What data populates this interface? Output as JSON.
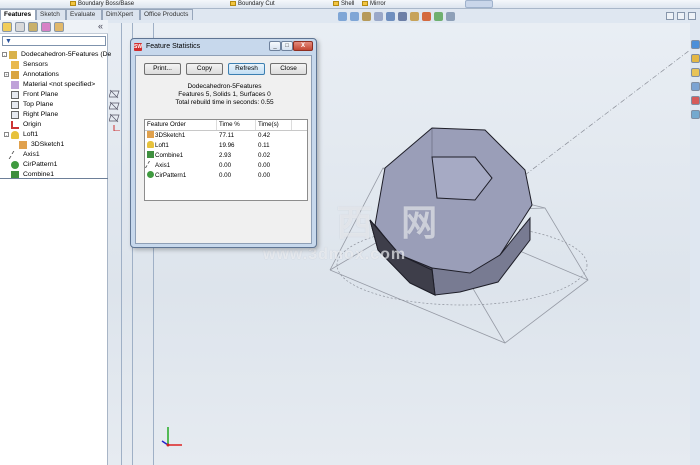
{
  "commandbar": {
    "items": [
      "Boundary Boss/Base",
      "Boundary Cut",
      "Shell",
      "Mirror"
    ]
  },
  "tabs": [
    "Features",
    "Sketch",
    "Evaluate",
    "DimXpert",
    "Office Products"
  ],
  "featuremanager": {
    "filter_icon": "funnel-icon",
    "collapse_glyph": "«",
    "items": [
      {
        "label": "Dodecahedron-5Features  (De",
        "icon": "part-icon",
        "expand": "-"
      },
      {
        "label": "Sensors",
        "icon": "sensor-icon",
        "expand": ""
      },
      {
        "label": "Annotations",
        "icon": "annotation-icon",
        "expand": "+"
      },
      {
        "label": "Material <not specified>",
        "icon": "material-icon",
        "expand": ""
      },
      {
        "label": "Front Plane",
        "icon": "plane-icon",
        "expand": ""
      },
      {
        "label": "Top Plane",
        "icon": "plane-icon",
        "expand": ""
      },
      {
        "label": "Right Plane",
        "icon": "plane-icon",
        "expand": ""
      },
      {
        "label": "Origin",
        "icon": "origin-icon",
        "expand": ""
      },
      {
        "label": "Loft1",
        "icon": "loft-icon",
        "expand": "-"
      },
      {
        "label": "3DSketch1",
        "icon": "sketch3d-icon",
        "expand": ""
      },
      {
        "label": "Axis1",
        "icon": "axis-icon",
        "expand": ""
      },
      {
        "label": "CirPattern1",
        "icon": "circular-pattern-icon",
        "expand": ""
      },
      {
        "label": "Combine1",
        "icon": "combine-icon",
        "expand": ""
      }
    ]
  },
  "dialog": {
    "title": "Feature Statistics",
    "logo": "SW",
    "window_buttons": {
      "minimize": "_",
      "maximize": "□",
      "close": "X"
    },
    "buttons": {
      "print": "Print...",
      "copy": "Copy",
      "refresh": "Refresh",
      "close": "Close"
    },
    "summary": {
      "name": "Dodecahedron-5Features",
      "counts": "Features 5, Solids 1, Surfaces 0",
      "rebuild": "Total rebuild time in seconds: 0.55"
    },
    "columns": [
      "Feature Order",
      "Time %",
      "Time(s)"
    ],
    "rows": [
      {
        "name": "3DSketch1",
        "icon": "sketch3d-icon",
        "percent": "77.11",
        "seconds": "0.42"
      },
      {
        "name": "Loft1",
        "icon": "loft-icon",
        "percent": "19.96",
        "seconds": "0.11"
      },
      {
        "name": "Combine1",
        "icon": "combine-icon",
        "percent": "2.93",
        "seconds": "0.02"
      },
      {
        "name": "Axis1",
        "icon": "axis-icon",
        "percent": "0.00",
        "seconds": "0.00"
      },
      {
        "name": "CirPattern1",
        "icon": "circular-pattern-icon",
        "percent": "0.00",
        "seconds": "0.00"
      }
    ]
  },
  "watermark": {
    "cn": "莫 西 网",
    "url": "www.3dmox.com"
  },
  "colors": {
    "accent": "#3c7fb1",
    "panel_bg": "#c7d8ec",
    "solid": "#8e92ad"
  }
}
